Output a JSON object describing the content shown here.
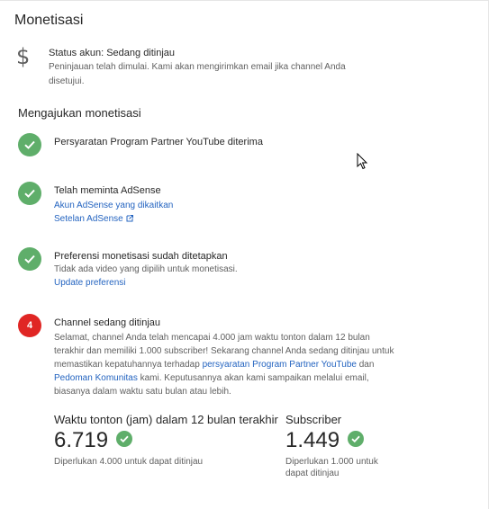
{
  "monetization": {
    "title": "Monetisasi",
    "status": {
      "icon": "dollar-icon",
      "title": "Status akun: Sedang ditinjau",
      "description": "Peninjauan telah dimulai. Kami akan mengirimkan email jika channel Anda disetujui."
    }
  },
  "apply": {
    "title": "Mengajukan monetisasi",
    "steps": [
      {
        "state": "done",
        "title": "Persyaratan Program Partner YouTube diterima"
      },
      {
        "state": "done",
        "title": "Telah meminta AdSense",
        "links": [
          "Akun AdSense yang dikaitkan",
          "Setelan AdSense"
        ]
      },
      {
        "state": "done",
        "title": "Preferensi monetisasi sudah ditetapkan",
        "description": "Tidak ada video yang dipilih untuk monetisasi.",
        "links": [
          "Update preferensi"
        ]
      },
      {
        "state": "in-progress",
        "number": "4",
        "title": "Channel sedang ditinjau",
        "description_part1": "Selamat, channel Anda telah mencapai 4.000 jam waktu tonton dalam 12 bulan terakhir dan memiliki 1.000 subscriber! Sekarang channel Anda sedang ditinjau untuk memastikan kepatuhannya terhadap ",
        "link1": "persyaratan Program Partner YouTube",
        "description_part2": " dan ",
        "link2": "Pedoman Komunitas",
        "description_part3": " kami. Keputusannya akan kami sampaikan melalui email, biasanya dalam waktu satu bulan atau lebih."
      }
    ],
    "metrics": [
      {
        "label": "Waktu tonton (jam) dalam 12 bulan terakhir",
        "value": "6.719",
        "note": "Diperlukan 4.000 untuk dapat ditinjau"
      },
      {
        "label": "Subscriber",
        "value": "1.449",
        "note": "Diperlukan 1.000 untuk dapat ditinjau"
      }
    ]
  },
  "colors": {
    "success": "#5fae6a",
    "alert": "#e02624",
    "link": "#2464c0",
    "secondary_text": "#606060"
  }
}
